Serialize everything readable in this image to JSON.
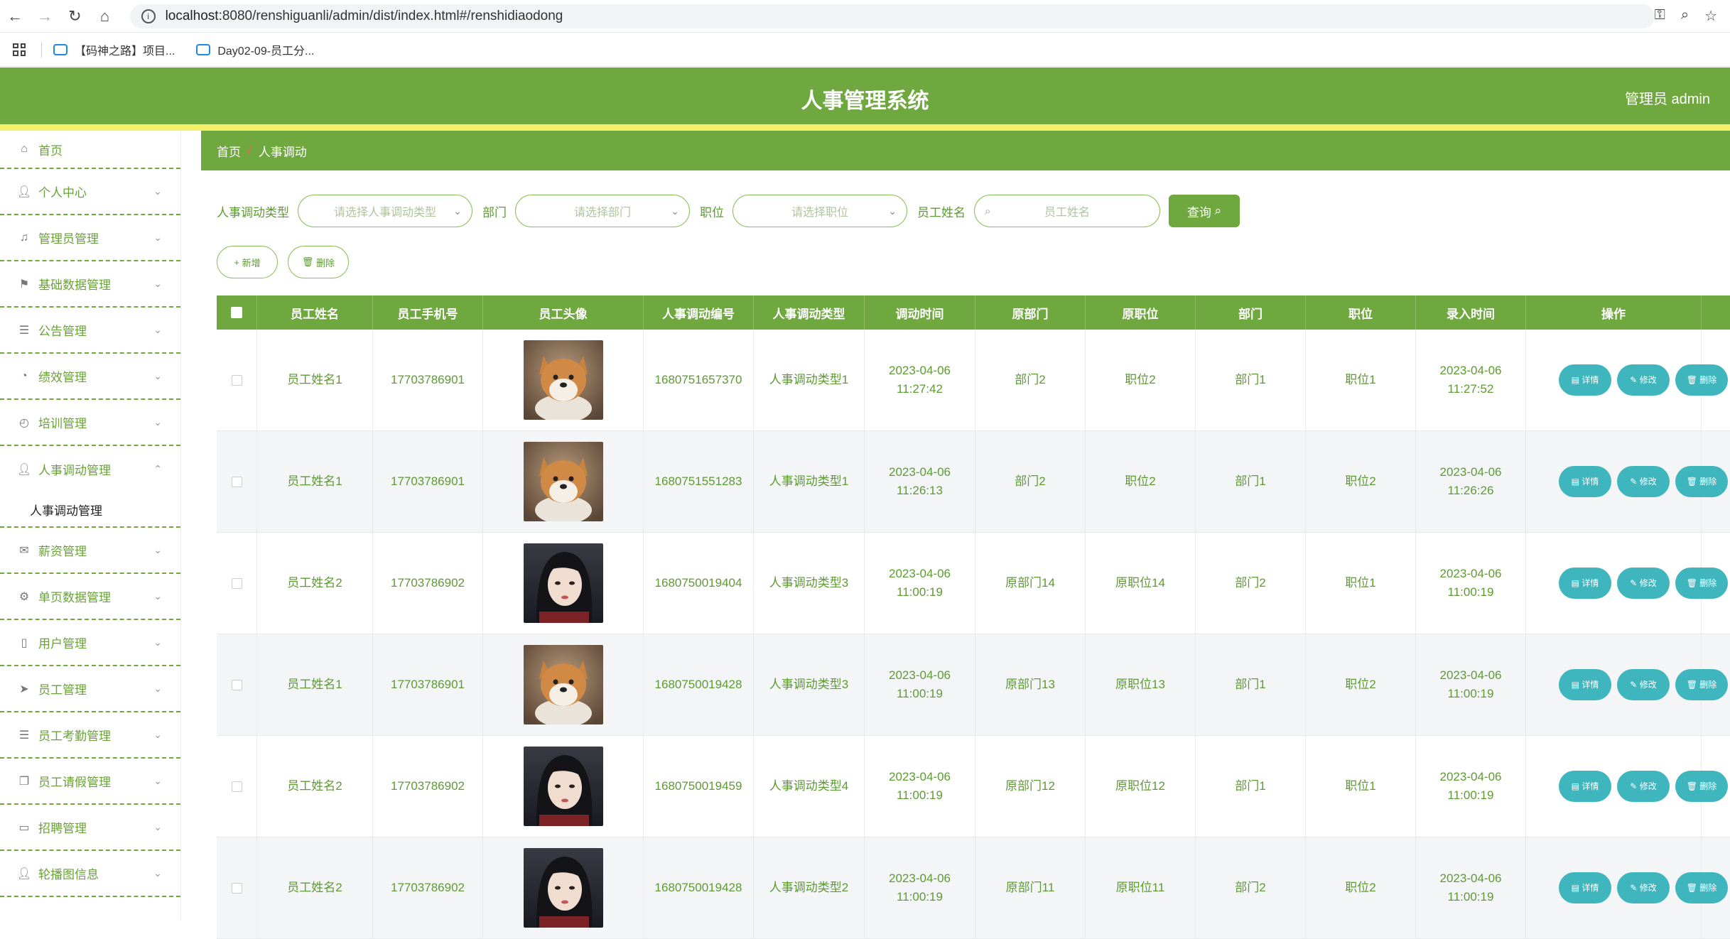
{
  "browser": {
    "url_host": "localhost",
    "url_rest": ":8080/renshiguanli/admin/dist/index.html#/renshidiaodong",
    "bookmarks": [
      "【码神之路】项目...",
      "Day02-09-员工分..."
    ]
  },
  "header": {
    "title": "人事管理系统",
    "user": "管理员 admin"
  },
  "sidebar": {
    "items": [
      {
        "label": "首页",
        "icon": "home-icon"
      },
      {
        "label": "个人中心",
        "icon": "user-icon"
      },
      {
        "label": "管理员管理",
        "icon": "bell-icon"
      },
      {
        "label": "基础数据管理",
        "icon": "flag-icon"
      },
      {
        "label": "公告管理",
        "icon": "list-icon"
      },
      {
        "label": "绩效管理",
        "icon": "gauge-icon"
      },
      {
        "label": "培训管理",
        "icon": "compass-icon"
      },
      {
        "label": "人事调动管理",
        "icon": "user-icon"
      },
      {
        "label": "薪资管理",
        "icon": "mail-icon"
      },
      {
        "label": "单页数据管理",
        "icon": "settings-icon"
      },
      {
        "label": "用户管理",
        "icon": "phone-icon"
      },
      {
        "label": "员工管理",
        "icon": "send-icon"
      },
      {
        "label": "员工考勤管理",
        "icon": "list-icon"
      },
      {
        "label": "员工请假管理",
        "icon": "copy-icon"
      },
      {
        "label": "招聘管理",
        "icon": "card-icon"
      },
      {
        "label": "轮播图信息",
        "icon": "user-icon"
      }
    ],
    "sub_item": "人事调动管理"
  },
  "breadcrumb": {
    "home": "首页",
    "sep": "/",
    "current": "人事调动"
  },
  "search": {
    "type_label": "人事调动类型",
    "type_placeholder": "请选择人事调动类型",
    "dept_label": "部门",
    "dept_placeholder": "请选择部门",
    "pos_label": "职位",
    "pos_placeholder": "请选择职位",
    "name_label": "员工姓名",
    "name_placeholder": "员工姓名",
    "query_label": "查询"
  },
  "actions": {
    "add": "新增",
    "delete": "删除"
  },
  "table": {
    "headers": [
      "员工姓名",
      "员工手机号",
      "员工头像",
      "人事调动编号",
      "人事调动类型",
      "调动时间",
      "原部门",
      "原职位",
      "部门",
      "职位",
      "录入时间",
      "操作"
    ],
    "op_labels": {
      "detail": "详情",
      "edit": "修改",
      "delete": "删除"
    },
    "rows": [
      {
        "name": "员工姓名1",
        "phone": "17703786901",
        "avatar": "dog",
        "no": "1680751657370",
        "type": "人事调动类型1",
        "time": "2023-04-06 11:27:42",
        "old_dept": "部门2",
        "old_pos": "职位2",
        "dept": "部门1",
        "pos": "职位1",
        "created": "2023-04-06 11:27:52"
      },
      {
        "name": "员工姓名1",
        "phone": "17703786901",
        "avatar": "dog",
        "no": "1680751551283",
        "type": "人事调动类型1",
        "time": "2023-04-06 11:26:13",
        "old_dept": "部门2",
        "old_pos": "职位2",
        "dept": "部门1",
        "pos": "职位2",
        "created": "2023-04-06 11:26:26"
      },
      {
        "name": "员工姓名2",
        "phone": "17703786902",
        "avatar": "girl",
        "no": "1680750019404",
        "type": "人事调动类型3",
        "time": "2023-04-06 11:00:19",
        "old_dept": "原部门14",
        "old_pos": "原职位14",
        "dept": "部门2",
        "pos": "职位1",
        "created": "2023-04-06 11:00:19"
      },
      {
        "name": "员工姓名1",
        "phone": "17703786901",
        "avatar": "dog",
        "no": "1680750019428",
        "type": "人事调动类型3",
        "time": "2023-04-06 11:00:19",
        "old_dept": "原部门13",
        "old_pos": "原职位13",
        "dept": "部门1",
        "pos": "职位2",
        "created": "2023-04-06 11:00:19"
      },
      {
        "name": "员工姓名2",
        "phone": "17703786902",
        "avatar": "girl",
        "no": "1680750019459",
        "type": "人事调动类型4",
        "time": "2023-04-06 11:00:19",
        "old_dept": "原部门12",
        "old_pos": "原职位12",
        "dept": "部门1",
        "pos": "职位1",
        "created": "2023-04-06 11:00:19"
      },
      {
        "name": "员工姓名2",
        "phone": "17703786902",
        "avatar": "girl",
        "no": "1680750019428",
        "type": "人事调动类型2",
        "time": "2023-04-06 11:00:19",
        "old_dept": "原部门11",
        "old_pos": "原职位11",
        "dept": "部门2",
        "pos": "职位2",
        "created": "2023-04-06 11:00:19"
      }
    ]
  },
  "colors": {
    "primary": "#70a840",
    "accent_bar": "#f5f06a",
    "op_button": "#3fb6bd"
  }
}
